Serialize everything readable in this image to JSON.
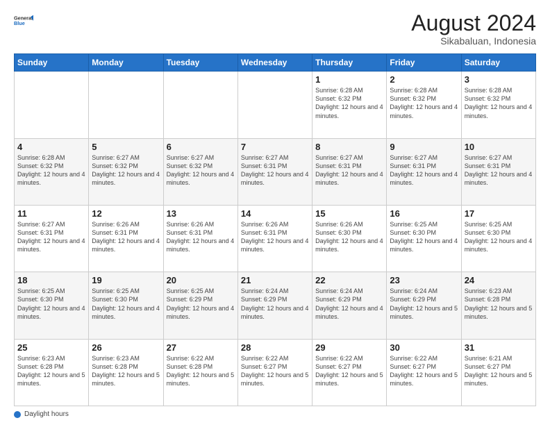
{
  "header": {
    "logo_line1": "General",
    "logo_line2": "Blue",
    "month_year": "August 2024",
    "location": "Sikabaluan, Indonesia"
  },
  "days_of_week": [
    "Sunday",
    "Monday",
    "Tuesday",
    "Wednesday",
    "Thursday",
    "Friday",
    "Saturday"
  ],
  "weeks": [
    [
      {
        "day": "",
        "info": ""
      },
      {
        "day": "",
        "info": ""
      },
      {
        "day": "",
        "info": ""
      },
      {
        "day": "",
        "info": ""
      },
      {
        "day": "1",
        "info": "Sunrise: 6:28 AM\nSunset: 6:32 PM\nDaylight: 12 hours\nand 4 minutes."
      },
      {
        "day": "2",
        "info": "Sunrise: 6:28 AM\nSunset: 6:32 PM\nDaylight: 12 hours\nand 4 minutes."
      },
      {
        "day": "3",
        "info": "Sunrise: 6:28 AM\nSunset: 6:32 PM\nDaylight: 12 hours\nand 4 minutes."
      }
    ],
    [
      {
        "day": "4",
        "info": "Sunrise: 6:28 AM\nSunset: 6:32 PM\nDaylight: 12 hours\nand 4 minutes."
      },
      {
        "day": "5",
        "info": "Sunrise: 6:27 AM\nSunset: 6:32 PM\nDaylight: 12 hours\nand 4 minutes."
      },
      {
        "day": "6",
        "info": "Sunrise: 6:27 AM\nSunset: 6:32 PM\nDaylight: 12 hours\nand 4 minutes."
      },
      {
        "day": "7",
        "info": "Sunrise: 6:27 AM\nSunset: 6:31 PM\nDaylight: 12 hours\nand 4 minutes."
      },
      {
        "day": "8",
        "info": "Sunrise: 6:27 AM\nSunset: 6:31 PM\nDaylight: 12 hours\nand 4 minutes."
      },
      {
        "day": "9",
        "info": "Sunrise: 6:27 AM\nSunset: 6:31 PM\nDaylight: 12 hours\nand 4 minutes."
      },
      {
        "day": "10",
        "info": "Sunrise: 6:27 AM\nSunset: 6:31 PM\nDaylight: 12 hours\nand 4 minutes."
      }
    ],
    [
      {
        "day": "11",
        "info": "Sunrise: 6:27 AM\nSunset: 6:31 PM\nDaylight: 12 hours\nand 4 minutes."
      },
      {
        "day": "12",
        "info": "Sunrise: 6:26 AM\nSunset: 6:31 PM\nDaylight: 12 hours\nand 4 minutes."
      },
      {
        "day": "13",
        "info": "Sunrise: 6:26 AM\nSunset: 6:31 PM\nDaylight: 12 hours\nand 4 minutes."
      },
      {
        "day": "14",
        "info": "Sunrise: 6:26 AM\nSunset: 6:31 PM\nDaylight: 12 hours\nand 4 minutes."
      },
      {
        "day": "15",
        "info": "Sunrise: 6:26 AM\nSunset: 6:30 PM\nDaylight: 12 hours\nand 4 minutes."
      },
      {
        "day": "16",
        "info": "Sunrise: 6:25 AM\nSunset: 6:30 PM\nDaylight: 12 hours\nand 4 minutes."
      },
      {
        "day": "17",
        "info": "Sunrise: 6:25 AM\nSunset: 6:30 PM\nDaylight: 12 hours\nand 4 minutes."
      }
    ],
    [
      {
        "day": "18",
        "info": "Sunrise: 6:25 AM\nSunset: 6:30 PM\nDaylight: 12 hours\nand 4 minutes."
      },
      {
        "day": "19",
        "info": "Sunrise: 6:25 AM\nSunset: 6:30 PM\nDaylight: 12 hours\nand 4 minutes."
      },
      {
        "day": "20",
        "info": "Sunrise: 6:25 AM\nSunset: 6:29 PM\nDaylight: 12 hours\nand 4 minutes."
      },
      {
        "day": "21",
        "info": "Sunrise: 6:24 AM\nSunset: 6:29 PM\nDaylight: 12 hours\nand 4 minutes."
      },
      {
        "day": "22",
        "info": "Sunrise: 6:24 AM\nSunset: 6:29 PM\nDaylight: 12 hours\nand 4 minutes."
      },
      {
        "day": "23",
        "info": "Sunrise: 6:24 AM\nSunset: 6:29 PM\nDaylight: 12 hours\nand 5 minutes."
      },
      {
        "day": "24",
        "info": "Sunrise: 6:23 AM\nSunset: 6:28 PM\nDaylight: 12 hours\nand 5 minutes."
      }
    ],
    [
      {
        "day": "25",
        "info": "Sunrise: 6:23 AM\nSunset: 6:28 PM\nDaylight: 12 hours\nand 5 minutes."
      },
      {
        "day": "26",
        "info": "Sunrise: 6:23 AM\nSunset: 6:28 PM\nDaylight: 12 hours\nand 5 minutes."
      },
      {
        "day": "27",
        "info": "Sunrise: 6:22 AM\nSunset: 6:28 PM\nDaylight: 12 hours\nand 5 minutes."
      },
      {
        "day": "28",
        "info": "Sunrise: 6:22 AM\nSunset: 6:27 PM\nDaylight: 12 hours\nand 5 minutes."
      },
      {
        "day": "29",
        "info": "Sunrise: 6:22 AM\nSunset: 6:27 PM\nDaylight: 12 hours\nand 5 minutes."
      },
      {
        "day": "30",
        "info": "Sunrise: 6:22 AM\nSunset: 6:27 PM\nDaylight: 12 hours\nand 5 minutes."
      },
      {
        "day": "31",
        "info": "Sunrise: 6:21 AM\nSunset: 6:27 PM\nDaylight: 12 hours\nand 5 minutes."
      }
    ]
  ],
  "legend": {
    "daylight_label": "Daylight hours"
  }
}
